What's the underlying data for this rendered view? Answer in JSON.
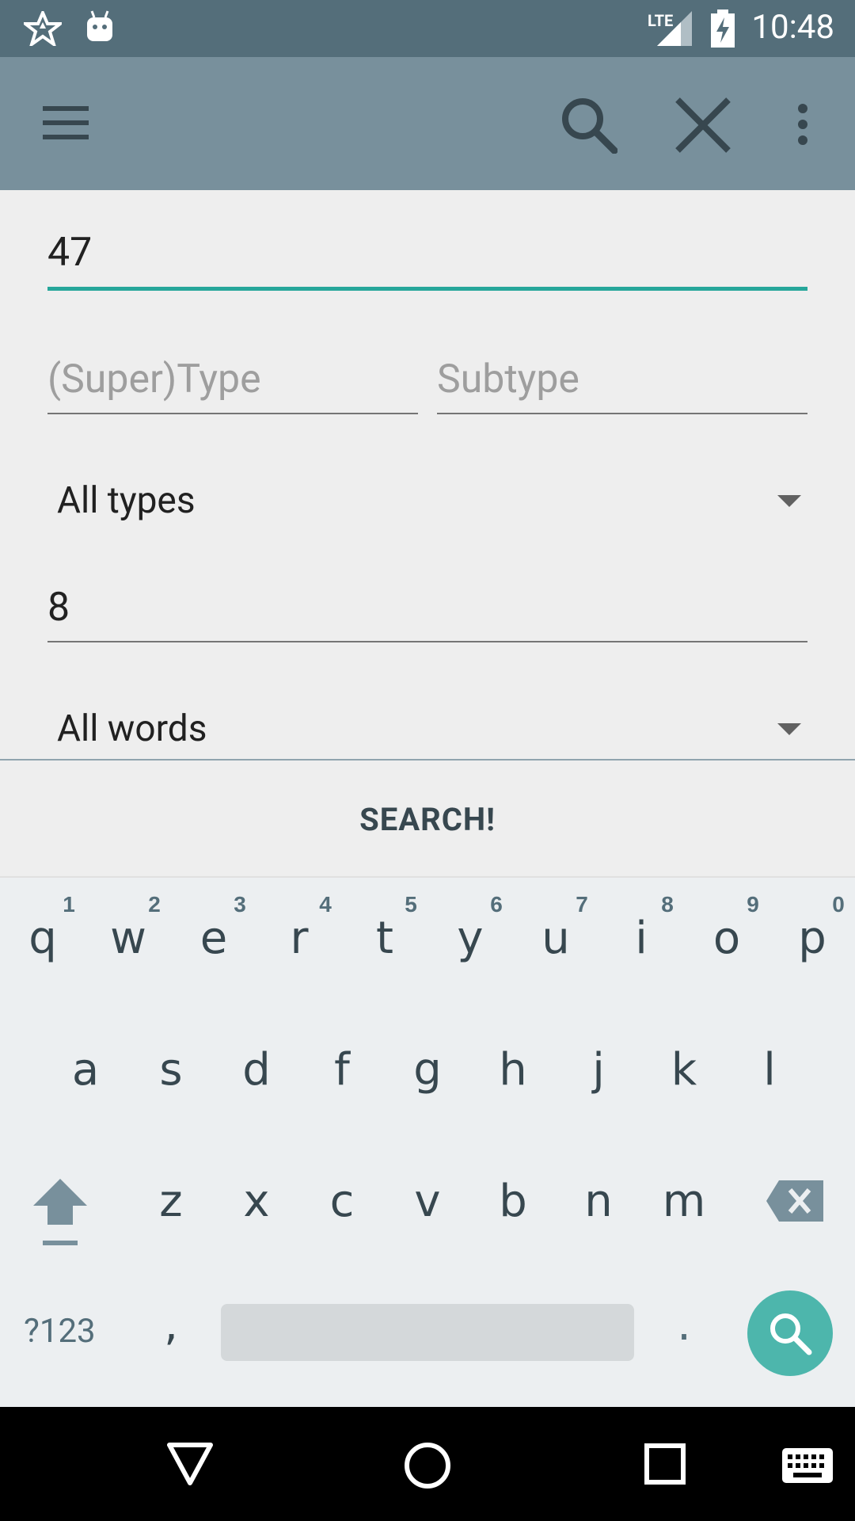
{
  "status_bar": {
    "time": "10:48",
    "network_label": "LTE"
  },
  "toolbar": {
    "menu_icon": "hamburger-menu-icon",
    "search_icon": "search-icon",
    "close_icon": "close-icon",
    "overflow_icon": "more-vert-icon"
  },
  "form": {
    "name_field": {
      "value": "47"
    },
    "supertype_field": {
      "placeholder": "(Super)Type"
    },
    "subtype_field": {
      "placeholder": "Subtype"
    },
    "type_spinner": {
      "selected": "All types"
    },
    "number_field": {
      "value": "8"
    },
    "words_spinner": {
      "selected": "All words"
    },
    "search_button": "SEARCH!"
  },
  "keyboard": {
    "row1": [
      {
        "key": "q",
        "hint": "1"
      },
      {
        "key": "w",
        "hint": "2"
      },
      {
        "key": "e",
        "hint": "3"
      },
      {
        "key": "r",
        "hint": "4"
      },
      {
        "key": "t",
        "hint": "5"
      },
      {
        "key": "y",
        "hint": "6"
      },
      {
        "key": "u",
        "hint": "7"
      },
      {
        "key": "i",
        "hint": "8"
      },
      {
        "key": "o",
        "hint": "9"
      },
      {
        "key": "p",
        "hint": "0"
      }
    ],
    "row2": [
      "a",
      "s",
      "d",
      "f",
      "g",
      "h",
      "j",
      "k",
      "l"
    ],
    "row3": [
      "z",
      "x",
      "c",
      "v",
      "b",
      "n",
      "m"
    ],
    "symbols_key": "?123",
    "comma_key": ",",
    "period_key": ".",
    "accent_color": "#4db6ac"
  },
  "colors": {
    "status_bar": "#546e7a",
    "toolbar": "#78909c",
    "focus_underline": "#26a69a"
  }
}
